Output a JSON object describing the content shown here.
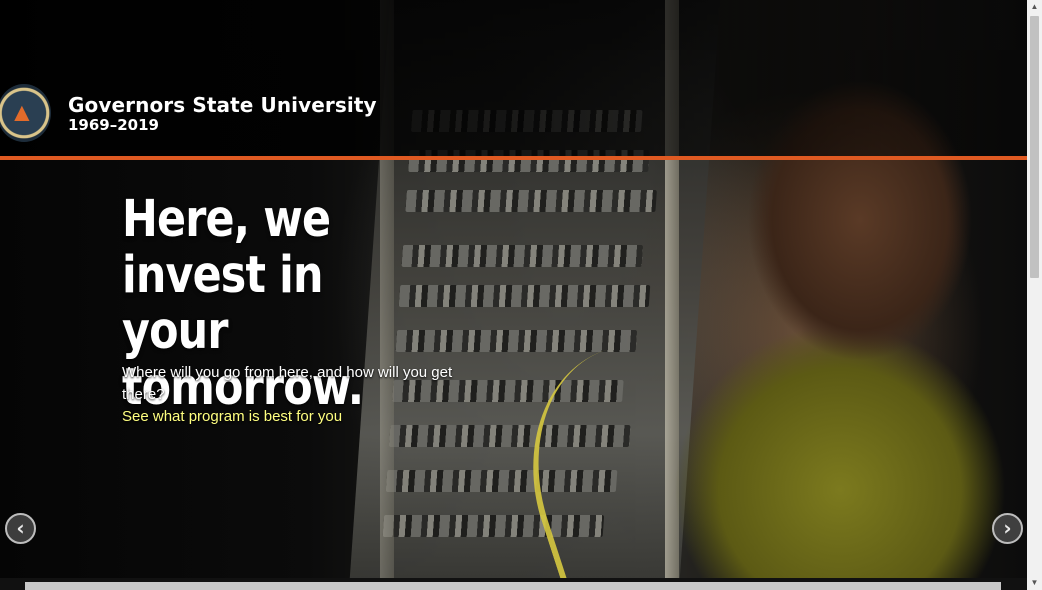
{
  "header": {
    "university_name": "Governors State University",
    "years": "1969–2019"
  },
  "hero": {
    "headline": "Here, we invest in your tomorrow.",
    "subtext": "Where will you go from here, and how will you get there?",
    "cta_link": "See what program is best for you"
  },
  "carousel": {
    "prev_icon": "chevron-left-icon",
    "next_icon": "chevron-right-icon",
    "prev_glyph": "‹",
    "next_glyph": "›"
  },
  "scrollbar": {
    "up_glyph": "▲",
    "down_glyph": "▼"
  },
  "colors": {
    "accent_rule": "#e05a22",
    "cta_text": "#ffff80",
    "seal_gold": "#d9c48a"
  }
}
